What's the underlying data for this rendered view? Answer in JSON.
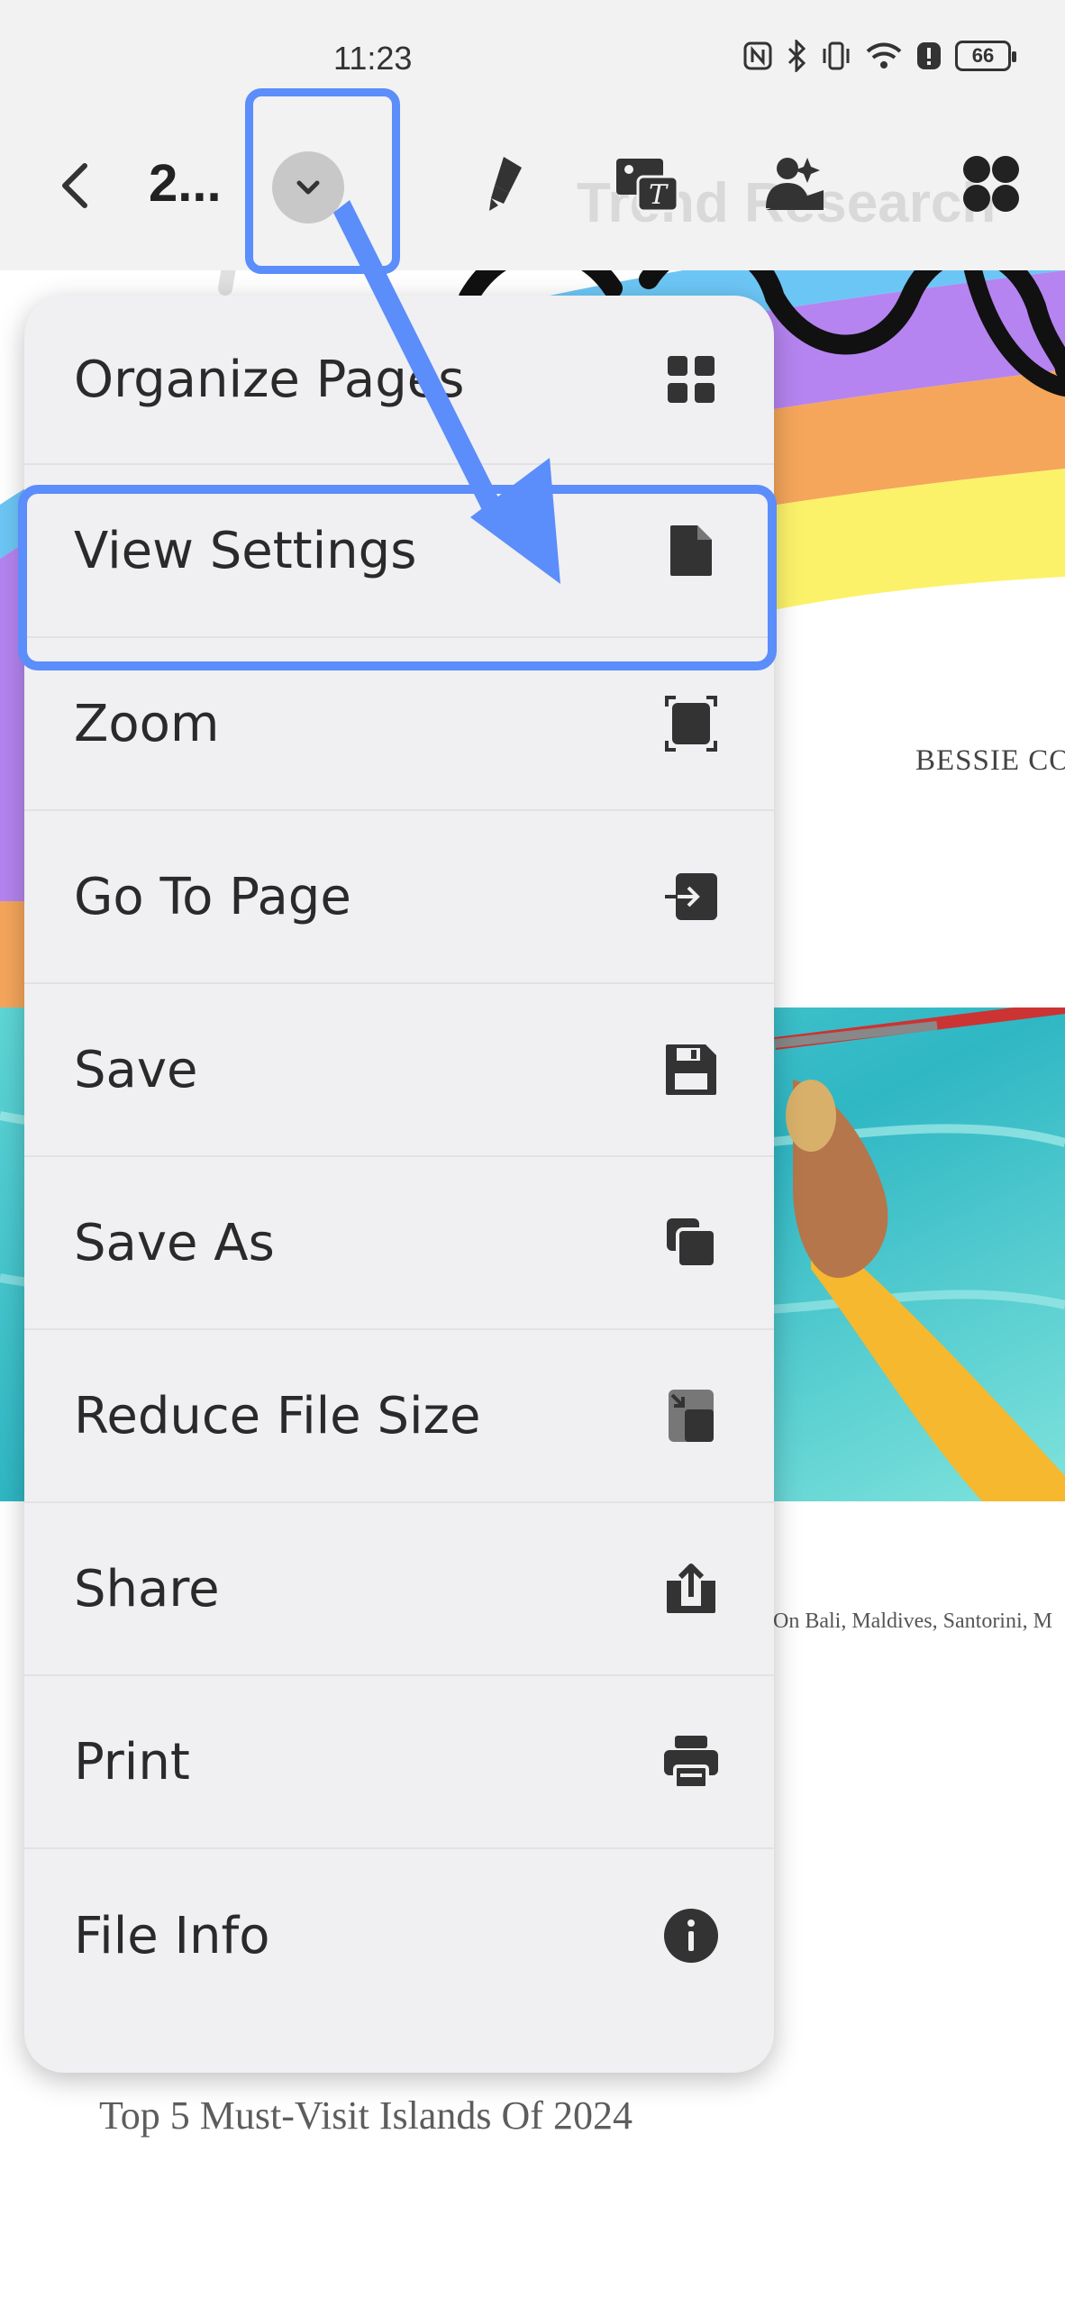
{
  "status_bar": {
    "time": "11:23",
    "battery": "66",
    "icons": [
      "nfc-icon",
      "bluetooth-icon",
      "vibrate-icon",
      "wifi-icon",
      "alert-icon",
      "battery-icon"
    ]
  },
  "toolbar": {
    "back_icon": "chevron-left-icon",
    "title": "2...",
    "dropdown_icon": "chevron-down-icon",
    "tools": [
      "highlighter-icon",
      "image-text-icon",
      "ai-image-icon",
      "apps-icon"
    ],
    "watermark": "Trend Research"
  },
  "menu": {
    "items": [
      {
        "label": "Organize Pages",
        "icon": "grid-icon"
      },
      {
        "label": "View Settings",
        "icon": "document-icon"
      },
      {
        "label": "Zoom",
        "icon": "zoom-frame-icon"
      },
      {
        "label": "Go To Page",
        "icon": "go-to-page-icon"
      },
      {
        "label": "Save",
        "icon": "save-icon"
      },
      {
        "label": "Save As",
        "icon": "save-as-icon"
      },
      {
        "label": "Reduce File Size",
        "icon": "reduce-size-icon"
      },
      {
        "label": "Share",
        "icon": "share-icon"
      },
      {
        "label": "Print",
        "icon": "print-icon"
      },
      {
        "label": "File Info",
        "icon": "info-icon"
      }
    ]
  },
  "document": {
    "author_fragment": "BESSIE CO",
    "caption_fragment": "On Bali, Maldives, Santorini, M",
    "heading": "Top 5 Must-Visit Islands Of 2024"
  },
  "colors": {
    "highlight": "#5b8dfb",
    "menu_bg": "#f0eff1",
    "toolbar_bg": "#f2f2f2"
  }
}
